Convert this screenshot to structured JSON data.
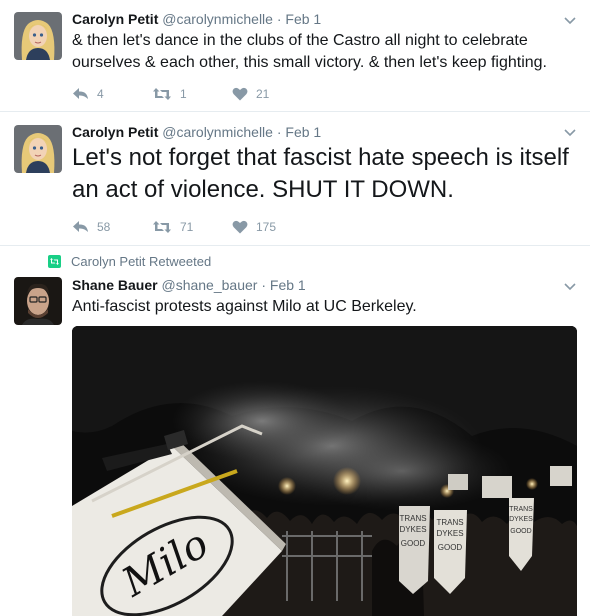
{
  "tweets": [
    {
      "name": "Carolyn Petit",
      "handle": "@carolynmichelle",
      "separator": "·",
      "time": "Feb 1",
      "text": "& then let's dance in the clubs of the Castro all night to celebrate ourselves & each other, this small victory. & then let's keep fighting.",
      "replies": "4",
      "retweets": "1",
      "likes": "21"
    },
    {
      "name": "Carolyn Petit",
      "handle": "@carolynmichelle",
      "separator": "·",
      "time": "Feb 1",
      "text": "Let's not forget that fascist hate speech is itself an act of violence. SHUT IT DOWN.",
      "replies": "58",
      "retweets": "71",
      "likes": "175"
    },
    {
      "retweet_context": "Carolyn Petit Retweeted",
      "name": "Shane Bauer",
      "handle": "@shane_bauer",
      "separator": "·",
      "time": "Feb 1",
      "text": "Anti-fascist protests against Milo at UC Berkeley.",
      "media": {
        "dumpster_graffiti": "Milo",
        "signs": [
          [
            "TRANS",
            "DYKES",
            "GOOD"
          ],
          [
            "TRANS",
            "DYKES",
            "GOOD"
          ],
          [
            "TRANS",
            "DYKES",
            "GOOD"
          ]
        ]
      }
    }
  ],
  "colors": {
    "primary_text": "#14171a",
    "secondary_text": "#657786",
    "action_icon": "#8899a6",
    "retweet_green": "#19cf86",
    "divider": "#e6ecf0"
  },
  "icons": [
    "reply-icon",
    "retweet-icon",
    "heart-icon",
    "chevron-down-icon",
    "retweeted-badge-icon"
  ]
}
